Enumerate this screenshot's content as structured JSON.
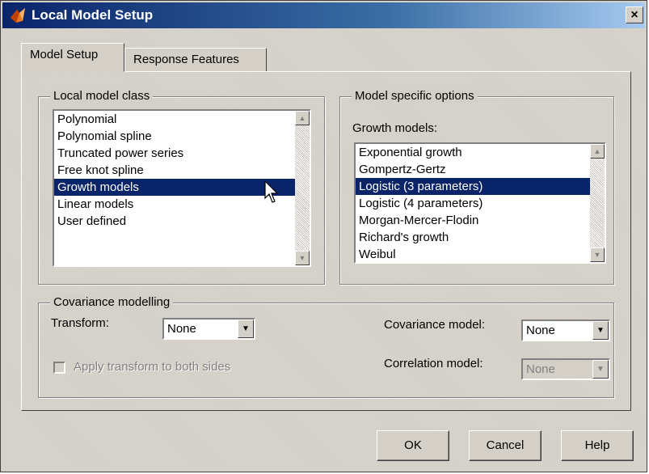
{
  "window": {
    "title": "Local Model Setup",
    "close_glyph": "×"
  },
  "tabs": [
    {
      "label": "Model Setup",
      "active": true
    },
    {
      "label": "Response Features",
      "active": false
    }
  ],
  "local_model_class": {
    "title": "Local model class",
    "items": [
      "Polynomial",
      "Polynomial spline",
      "Truncated power series",
      "Free knot spline",
      "Growth models",
      "Linear models",
      "User defined"
    ],
    "selected_index": 4
  },
  "model_specific": {
    "title": "Model specific options",
    "growth_label": "Growth models:",
    "items": [
      "Exponential growth",
      "Gompertz-Gertz",
      "Logistic (3 parameters)",
      "Logistic (4 parameters)",
      "Morgan-Mercer-Flodin",
      "Richard's growth",
      "Weibul"
    ],
    "selected_index": 2
  },
  "covariance": {
    "title": "Covariance modelling",
    "transform_label": "Transform:",
    "transform_value": "None",
    "apply_label": "Apply transform to both sides",
    "covariance_label": "Covariance model:",
    "covariance_value": "None",
    "correlation_label": "Correlation model:",
    "correlation_value": "None"
  },
  "buttons": {
    "ok": "OK",
    "cancel": "Cancel",
    "help": "Help"
  },
  "colors": {
    "selection": "#0a246a",
    "face": "#d4d0c8",
    "title_start": "#0a246a",
    "title_end": "#a6caf0"
  },
  "icons": {
    "scroll_up": "▲",
    "scroll_down": "▼",
    "combo": "▼"
  }
}
